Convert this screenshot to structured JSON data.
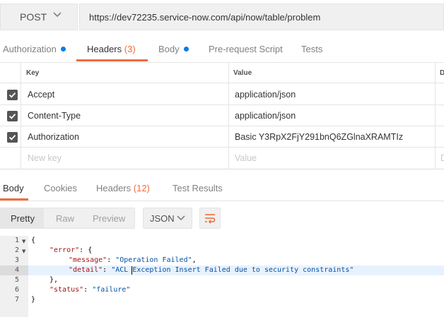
{
  "request": {
    "method": "POST",
    "url": "https://dev72235.service-now.com/api/now/table/problem"
  },
  "request_tabs": {
    "authorization": "Authorization",
    "headers": "Headers",
    "headers_count": "(3)",
    "body": "Body",
    "pre_request": "Pre-request Script",
    "tests": "Tests"
  },
  "headers_table": {
    "col_key": "Key",
    "col_value": "Value",
    "col_desc": "D",
    "rows": [
      {
        "key": "Accept",
        "value": "application/json",
        "checked": true
      },
      {
        "key": "Content-Type",
        "value": "application/json",
        "checked": true
      },
      {
        "key": "Authorization",
        "value": "Basic Y3RpX2FjY291bnQ6ZGlnaXRAMTIz",
        "checked": true
      }
    ],
    "new_key_placeholder": "New key",
    "new_value_placeholder": "Value",
    "new_desc_placeholder": "D"
  },
  "response_tabs": {
    "body": "Body",
    "cookies": "Cookies",
    "headers": "Headers",
    "headers_count": "(12)",
    "test_results": "Test Results"
  },
  "viewer": {
    "pretty": "Pretty",
    "raw": "Raw",
    "preview": "Preview",
    "format": "JSON"
  },
  "code": {
    "line_numbers": [
      "1",
      "2",
      "3",
      "4",
      "5",
      "6",
      "7"
    ],
    "l1": "{",
    "l2_key": "\"error\"",
    "l2_rest": ": {",
    "l3_key": "\"message\"",
    "l3_sep": ": ",
    "l3_val": "\"Operation Failed\"",
    "l3_end": ",",
    "l4_key": "\"detail\"",
    "l4_sep": ": ",
    "l4_val": "\"ACL Exception Insert Failed due to security constraints\"",
    "l5": "},",
    "l6_key": "\"status\"",
    "l6_sep": ": ",
    "l6_val": "\"failure\"",
    "l7": "}"
  },
  "colors": {
    "accent": "#f26b3a",
    "dot": "#097bed"
  }
}
